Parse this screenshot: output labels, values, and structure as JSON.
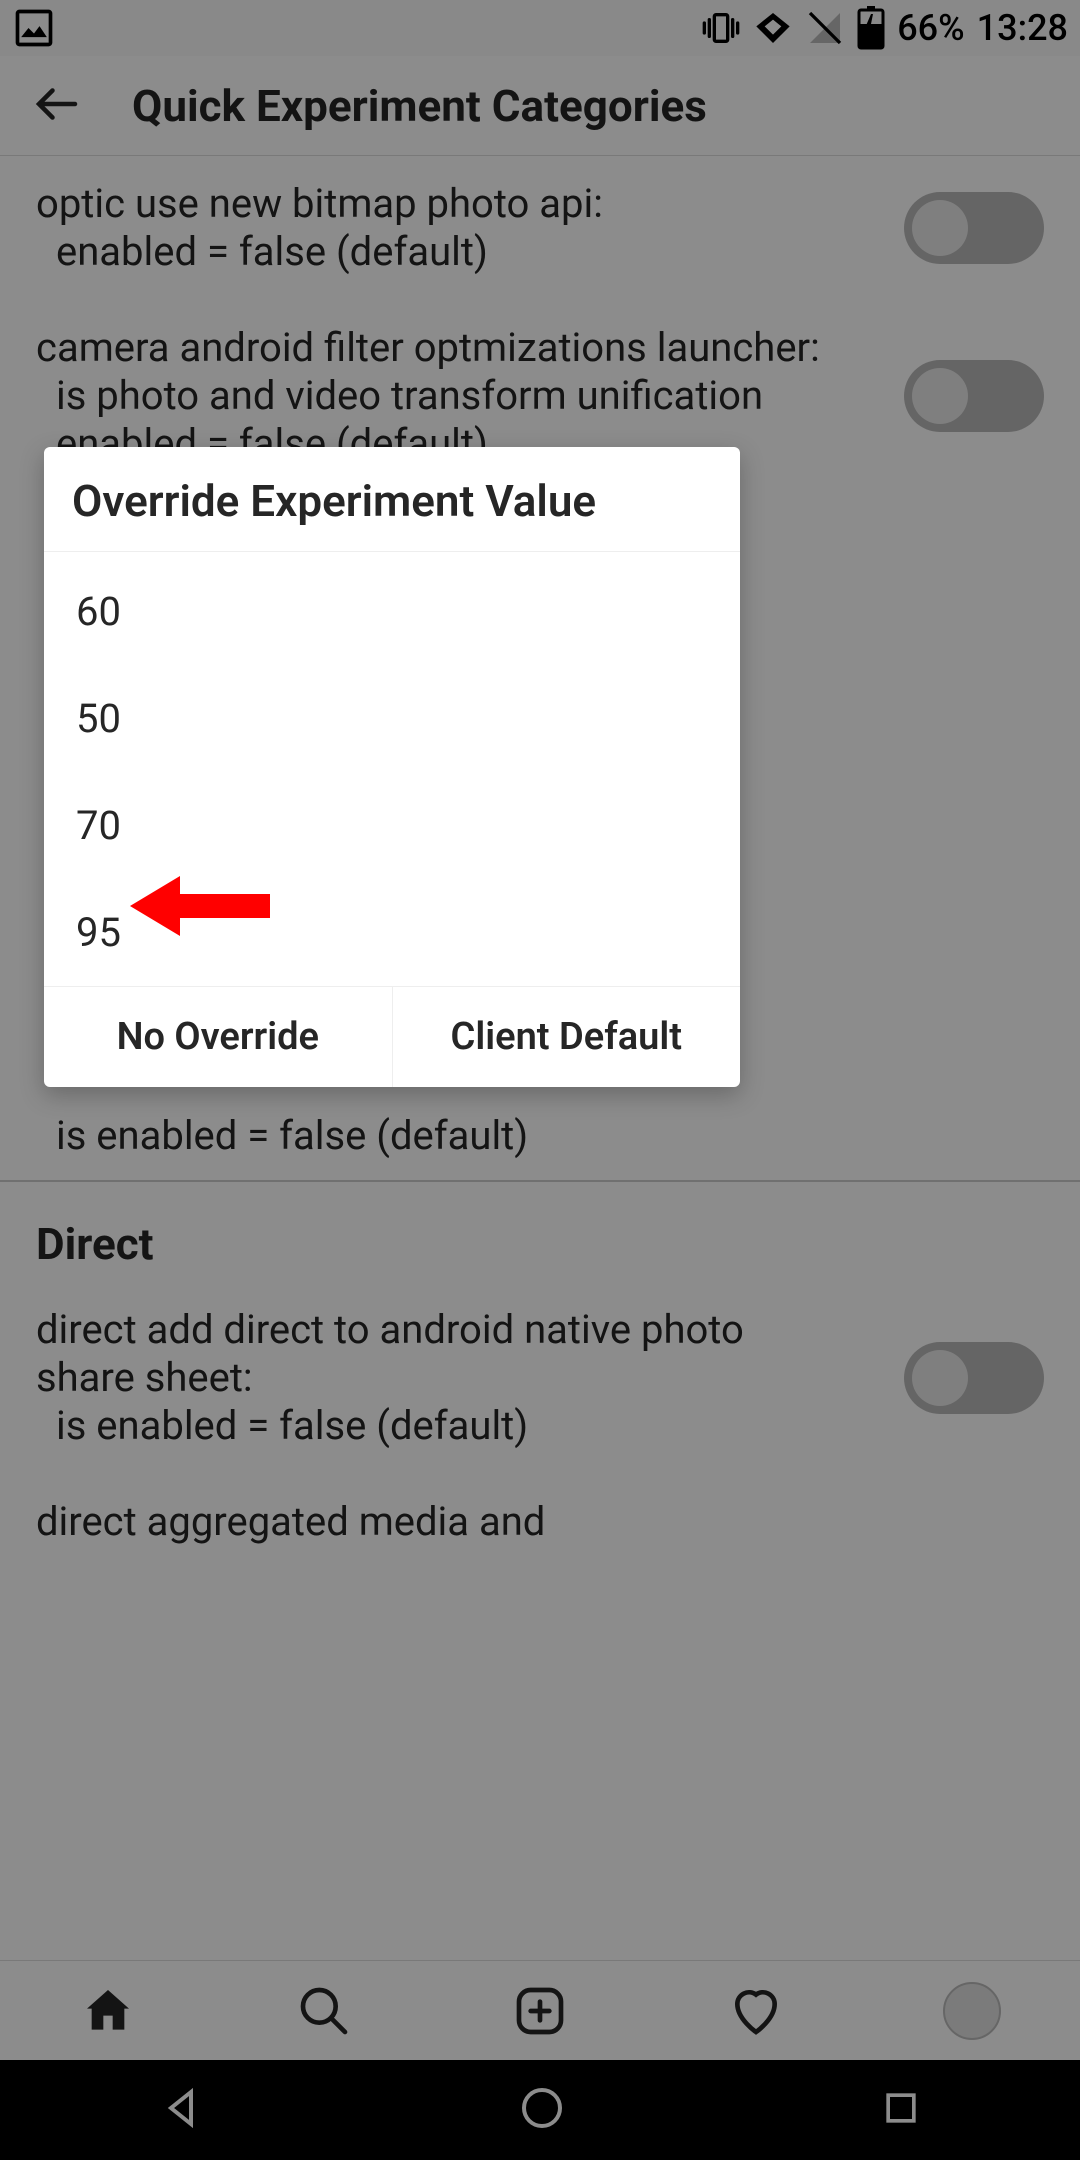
{
  "status": {
    "battery": "66%",
    "time": "13:28"
  },
  "header": {
    "title": "Quick Experiment Categories"
  },
  "experiments": [
    {
      "label": "optic use new bitmap photo api:",
      "sub": "enabled = false (default)",
      "toggle": false
    },
    {
      "label": "camera android filter optmizations launcher:",
      "sub": "is photo and video transform unification enabled = false (default)",
      "toggle": false
    }
  ],
  "partial_row": "is enabled = false (default)",
  "section2": "Direct",
  "experiments2": [
    {
      "label": "direct add direct to android native photo share sheet:",
      "sub": "is enabled = false (default)",
      "toggle": false
    },
    {
      "label_only": "direct aggregated media and"
    }
  ],
  "dialog": {
    "title": "Override Experiment Value",
    "options": [
      "60",
      "50",
      "70",
      "95"
    ],
    "no_override": "No Override",
    "client_default": "Client Default"
  }
}
